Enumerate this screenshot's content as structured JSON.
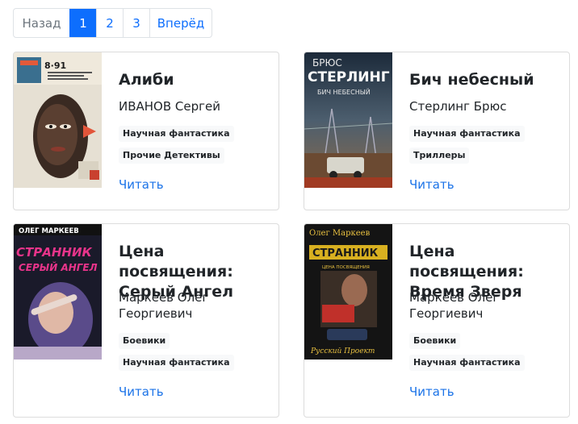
{
  "pagination": {
    "prev_label": "Назад",
    "pages": [
      "1",
      "2",
      "3"
    ],
    "active_page": "1",
    "next_label": "Вперёд"
  },
  "books": [
    {
      "title": "Алиби",
      "author": "ИВАНОВ Сергей",
      "tags": [
        "Научная фантастика",
        "Прочие Детективы"
      ],
      "read_label": "Читать",
      "cover": {
        "top_text": "8·91"
      }
    },
    {
      "title": "Бич небесный",
      "author": "Стерлинг Брюс",
      "tags": [
        "Научная фантастика",
        "Триллеры"
      ],
      "read_label": "Читать",
      "cover": {
        "top_text": "БРЮС",
        "main_text": "СТЕРЛИНГ",
        "sub_text": "БИЧ НЕБЕСНЫЙ"
      }
    },
    {
      "title": "Цена посвящения: Серый Ангел",
      "author": "Маркеев Олег Георгиевич",
      "tags": [
        "Боевики",
        "Научная фантастика"
      ],
      "read_label": "Читать",
      "cover": {
        "top_text": "ОЛЕГ МАРКЕЕВ",
        "main_text": "СТРАННИК",
        "sub_text": "СЕРЫЙ АНГЕЛ"
      }
    },
    {
      "title": "Цена посвящения: Время Зверя",
      "author": "Маркеев Олег Георгиевич",
      "tags": [
        "Боевики",
        "Научная фантастика"
      ],
      "read_label": "Читать",
      "cover": {
        "top_text": "Олег Маркеев",
        "main_text": "СТРАННИК",
        "sub_text": "ЦЕНА ПОСВЯЩЕНИЯ",
        "bottom_text": "Русский Проект"
      }
    }
  ]
}
